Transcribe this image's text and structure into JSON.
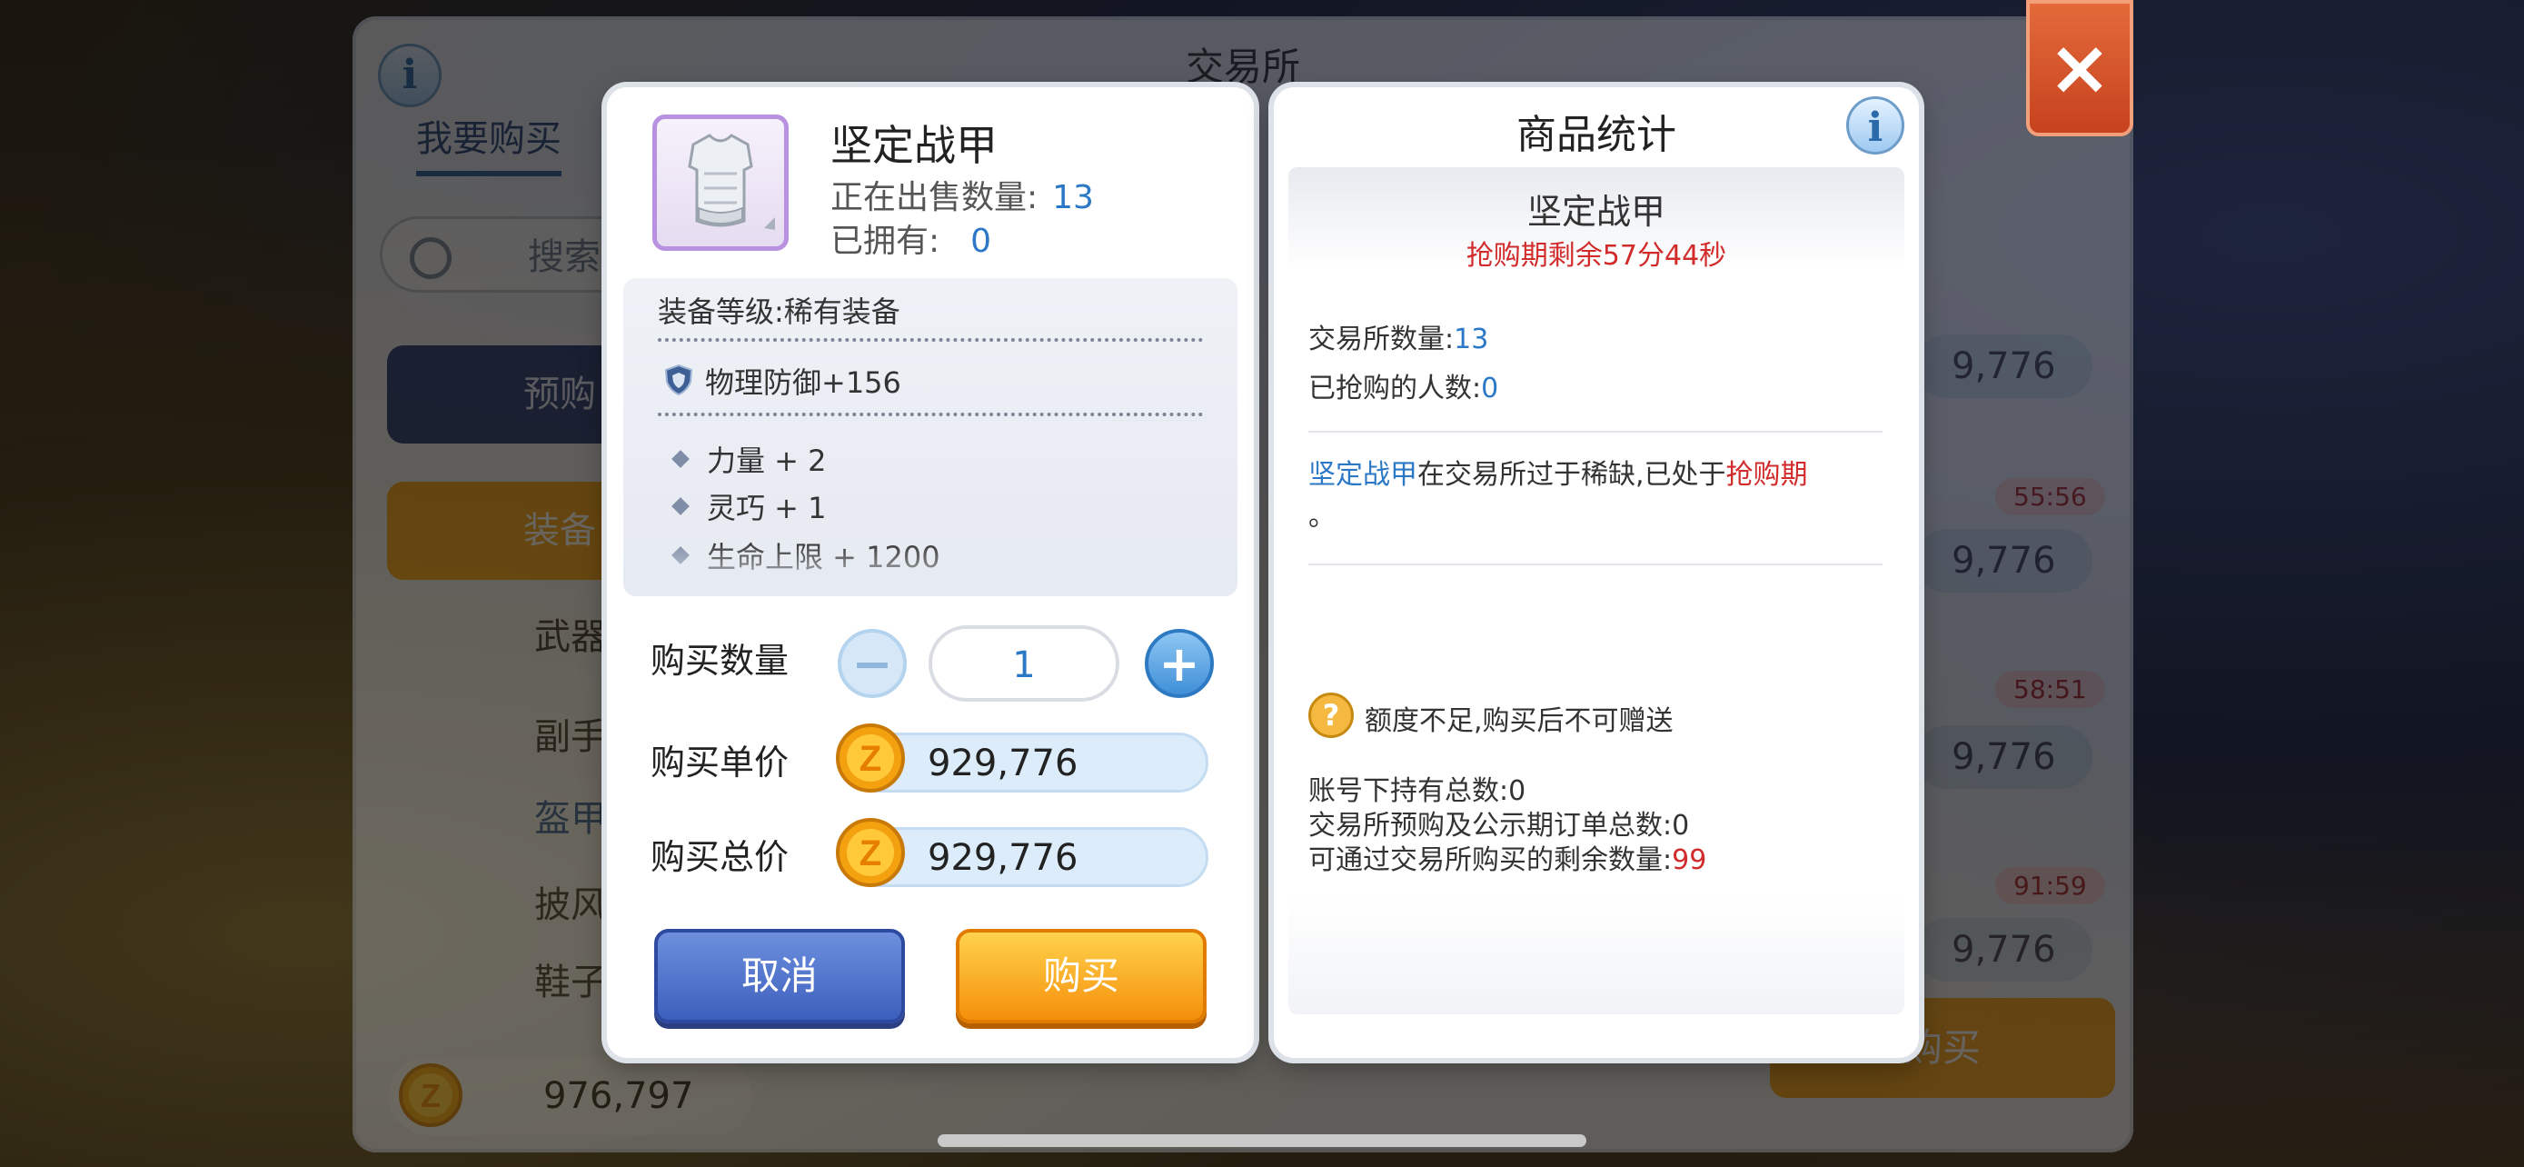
{
  "background_window": {
    "title": "交易所",
    "tab_buy": "我要购买",
    "search_placeholder": "搜索",
    "btn_preorder": "预购",
    "btn_equipment": "装备",
    "categories": [
      "武器",
      "副手",
      "盔甲",
      "披风",
      "鞋子"
    ],
    "balance": "976,797",
    "list_times": [
      "55:56",
      "58:51",
      "91:59"
    ],
    "list_prices": [
      "9,776",
      "9,776",
      "9,776",
      "9,776"
    ],
    "bottom_buy": "购买",
    "info_icon": "i"
  },
  "purchase_dialog": {
    "item_name": "坚定战甲",
    "on_sale_label": "正在出售数量:",
    "on_sale_value": "13",
    "owned_label": "已拥有:",
    "owned_value": "0",
    "equip_level": "装备等级:稀有装备",
    "defense": "物理防御+156",
    "bonuses": [
      "力量 + 2",
      "灵巧 + 1",
      "生命上限 + 1200"
    ],
    "quantity_label": "购买数量",
    "quantity_value": "1",
    "unit_price_label": "购买单价",
    "unit_price_value": "929,776",
    "total_price_label": "购买总价",
    "total_price_value": "929,776",
    "cancel_label": "取消",
    "buy_label": "购买",
    "minus_symbol": "−",
    "plus_symbol": "+"
  },
  "stats_dialog": {
    "title": "商品统计",
    "info_icon": "i",
    "item_name": "坚定战甲",
    "timer_text": "抢购期剩余57分44秒",
    "exchange_qty_label": "交易所数量:",
    "exchange_qty_value": "13",
    "grabbed_label": "已抢购的人数:",
    "grabbed_value": "0",
    "notice_item": "坚定战甲",
    "notice_mid": "在交易所过于稀缺,已处于",
    "notice_period": "抢购期",
    "notice_end": "。",
    "warning": "额度不足,购买后不可赠送",
    "account_total": "账号下持有总数:0",
    "preorder_total": "交易所预购及公示期订单总数:0",
    "remaining_label": "可通过交易所购买的剩余数量:",
    "remaining_value": "99"
  },
  "colors": {
    "accent_blue": "#2a78c6",
    "alert_red": "#d12b2b",
    "buy_orange": "#f58f0a",
    "cancel_blue": "#3d5fbd"
  },
  "icons": [
    "info-icon",
    "close-icon",
    "search-icon",
    "zeny-coin-icon",
    "shield-icon",
    "question-icon",
    "armor-item-icon"
  ]
}
